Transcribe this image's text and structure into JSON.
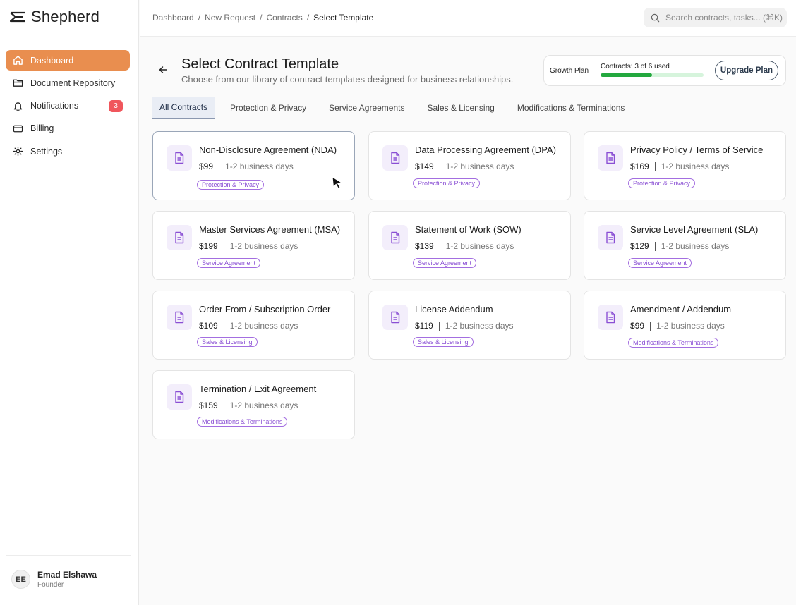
{
  "app": {
    "name": "Shepherd"
  },
  "sidebar": {
    "items": [
      {
        "label": "Dashboard",
        "icon": "home-icon",
        "active": true
      },
      {
        "label": "Document Repository",
        "icon": "folder-icon"
      },
      {
        "label": "Notifications",
        "icon": "bell-icon",
        "badge": "3"
      },
      {
        "label": "Billing",
        "icon": "credit-card-icon"
      },
      {
        "label": "Settings",
        "icon": "gear-icon"
      }
    ],
    "user": {
      "initials": "EE",
      "name": "Emad Elshawa",
      "role": "Founder"
    }
  },
  "header": {
    "breadcrumb": [
      "Dashboard",
      "/",
      "New Request",
      "/",
      "Contracts",
      "/",
      "Select Template"
    ],
    "search_placeholder": "Search contracts, tasks... (⌘K)"
  },
  "page": {
    "title": "Select Contract Template",
    "subtitle": "Choose from our library of contract templates designed for business relationships."
  },
  "plan": {
    "name": "Growth Plan",
    "usage_label": "Contracts: 3 of 6 used",
    "used_fraction": 0.5,
    "upgrade_label": "Upgrade Plan",
    "bar_color": "#23a83e"
  },
  "tabs": [
    "All Contracts",
    "Protection & Privacy",
    "Service Agreements",
    "Sales & Licensing",
    "Modifications & Terminations"
  ],
  "templates": [
    {
      "title": "Non-Disclosure Agreement (NDA)",
      "price": "$99",
      "turnaround": "1-2 business days",
      "tag": "Protection & Privacy"
    },
    {
      "title": "Data Processing Agreement (DPA)",
      "price": "$149",
      "turnaround": "1-2 business days",
      "tag": "Protection & Privacy"
    },
    {
      "title": "Privacy Policy / Terms of Service",
      "price": "$169",
      "turnaround": "1-2 business days",
      "tag": "Protection & Privacy"
    },
    {
      "title": "Master Services Agreement (MSA)",
      "price": "$199",
      "turnaround": "1-2 business days",
      "tag": "Service Agreement"
    },
    {
      "title": "Statement of Work (SOW)",
      "price": "$139",
      "turnaround": "1-2 business days",
      "tag": "Service Agreement"
    },
    {
      "title": "Service Level Agreement (SLA)",
      "price": "$129",
      "turnaround": "1-2 business days",
      "tag": "Service Agreement"
    },
    {
      "title": "Order From / Subscription Order",
      "price": "$109",
      "turnaround": "1-2 business days",
      "tag": "Sales & Licensing"
    },
    {
      "title": "License Addendum",
      "price": "$119",
      "turnaround": "1-2 business days",
      "tag": "Sales & Licensing"
    },
    {
      "title": "Amendment / Addendum",
      "price": "$99",
      "turnaround": "1-2 business days",
      "tag": "Modifications & Terminations"
    },
    {
      "title": "Termination / Exit Agreement",
      "price": "$159",
      "turnaround": "1-2 business days",
      "tag": "Modifications & Terminations"
    }
  ],
  "colors": {
    "accent": "#e98e4f",
    "tag": "#8a4fd4",
    "badge": "#f0565c"
  }
}
